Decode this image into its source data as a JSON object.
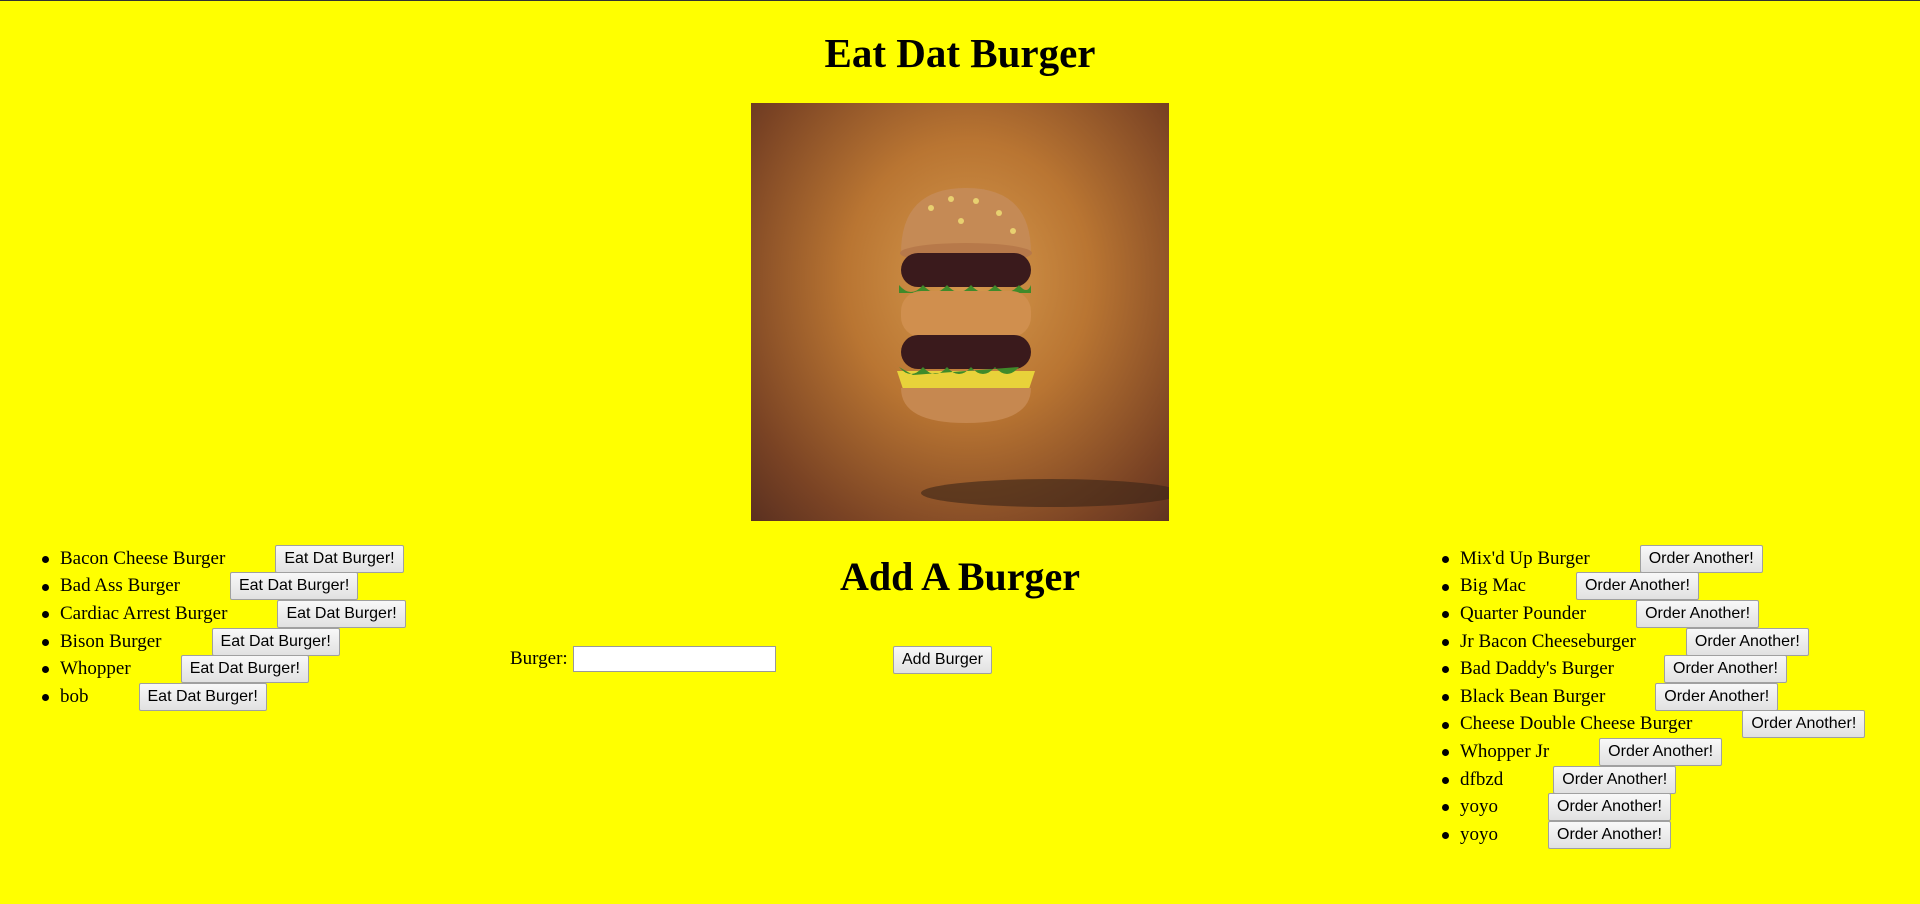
{
  "page": {
    "title": "Eat Dat Burger"
  },
  "hero_image": {
    "alt": "burger"
  },
  "add_form": {
    "heading": "Add A Burger",
    "label": "Burger:",
    "input_value": "",
    "button_label": "Add Burger"
  },
  "uneaten": {
    "button_label": "Eat Dat Burger!",
    "items": [
      {
        "name": "Bacon Cheese Burger",
        "gap": 50
      },
      {
        "name": "Bad Ass Burger",
        "gap": 50
      },
      {
        "name": "Cardiac Arrest Burger",
        "gap": 50
      },
      {
        "name": "Bison Burger",
        "gap": 50
      },
      {
        "name": "Whopper",
        "gap": 50
      },
      {
        "name": "bob",
        "gap": 50
      }
    ]
  },
  "devoured": {
    "button_label": "Order Another!",
    "items": [
      {
        "name": "Mix'd Up Burger"
      },
      {
        "name": "Big Mac"
      },
      {
        "name": "Quarter Pounder"
      },
      {
        "name": "Jr Bacon Cheeseburger"
      },
      {
        "name": "Bad Daddy's Burger"
      },
      {
        "name": "Black Bean Burger"
      },
      {
        "name": "Cheese Double Cheese Burger"
      },
      {
        "name": "Whopper Jr"
      },
      {
        "name": "dfbzd"
      },
      {
        "name": "yoyo"
      },
      {
        "name": "yoyo"
      }
    ]
  }
}
